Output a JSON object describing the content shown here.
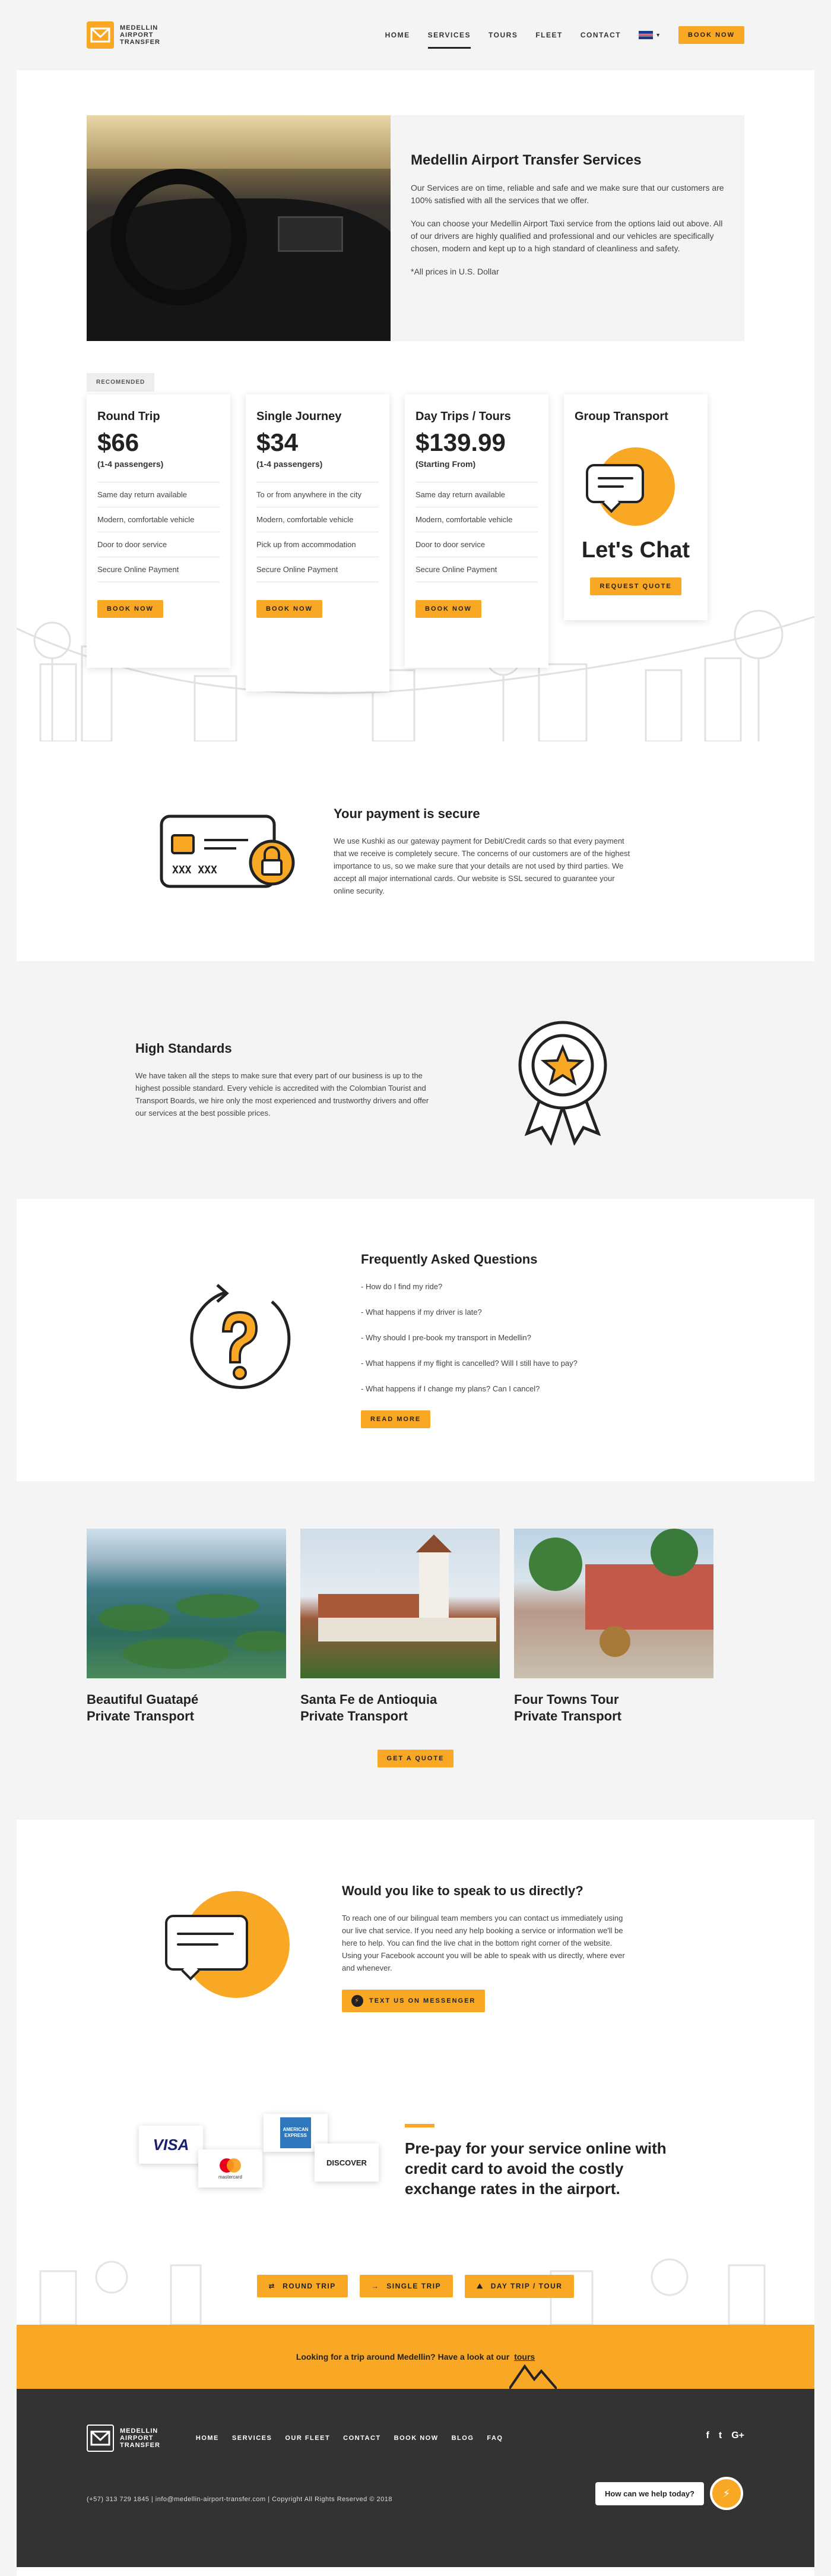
{
  "header": {
    "logo_line1": "MEDELLIN",
    "logo_line2": "AIRPORT",
    "logo_line3": "TRANSFER",
    "nav": [
      "HOME",
      "SERVICES",
      "TOURS",
      "FLEET",
      "CONTACT"
    ],
    "active_nav": "SERVICES",
    "book_now": "BOOK NOW"
  },
  "services": {
    "title": "Medellin Airport Transfer Services",
    "p1": "Our Services are on time, reliable and safe and we make sure that our customers are 100% satisfied with all the services that we offer.",
    "p2": "You can choose your Medellin Airport Taxi service from the options laid out above. All of our drivers are highly qualified and professional and our vehicles are specifically chosen, modern and kept up to a high standard of cleanliness and safety.",
    "p3": "*All prices in U.S. Dollar"
  },
  "pricing": {
    "recommended": "RECOMENDED",
    "cards": [
      {
        "title": "Round Trip",
        "price": "$66",
        "pax": "(1-4 passengers)",
        "features": [
          "Same day return available",
          "Modern, comfortable vehicle",
          "Door to door service",
          "Secure Online Payment"
        ],
        "button": "BOOK NOW"
      },
      {
        "title": "Single Journey",
        "price": "$34",
        "pax": "(1-4 passengers)",
        "features": [
          "To or from anywhere in the city",
          "Modern, comfortable vehicle",
          "Pick up from accommodation",
          "Secure Online Payment"
        ],
        "button": "BOOK NOW"
      },
      {
        "title": "Day Trips / Tours",
        "price": "$139.99",
        "pax": "(Starting From)",
        "features": [
          "Same day return available",
          "Modern, comfortable vehicle",
          "Door to door service",
          "Secure Online Payment"
        ],
        "button": "BOOK NOW"
      },
      {
        "title": "Group Transport",
        "lets_chat": "Let's Chat",
        "button": "REQUEST QUOTE"
      }
    ]
  },
  "payment": {
    "title": "Your payment is secure",
    "text": "We use Kushki as our gateway payment for Debit/Credit cards so that every payment that we receive is completely secure. The concerns of our customers are of the highest importance to us, so we make sure that your details are not used by third parties. We accept all major international cards. Our website is SSL secured to guarantee your online security.",
    "card_icon_text": "XXX XXX"
  },
  "standards": {
    "title": "High Standards",
    "text": "We have taken all the steps to make sure that every part of our business is up to the highest possible standard. Every vehicle is accredited with the Colombian Tourist and Transport Boards, we hire only the most experienced and trustworthy drivers and offer our services at the best possible prices."
  },
  "faq": {
    "title": "Frequently Asked Questions",
    "items": [
      "- How do I find my ride?",
      "- What happens if my driver is late?",
      "- Why should I pre-book my transport in Medellin?",
      "- What happens if my flight is cancelled? Will I still have to pay?",
      "- What happens if I change my plans? Can I cancel?"
    ],
    "button": "READ MORE"
  },
  "tours": {
    "items": [
      {
        "line1": "Beautiful Guatapé",
        "line2": "Private Transport"
      },
      {
        "line1": "Santa Fe de Antioquia",
        "line2": "Private Transport"
      },
      {
        "line1": "Four Towns Tour",
        "line2": "Private Transport"
      }
    ],
    "button": "GET A QUOTE"
  },
  "speak": {
    "title": "Would you like to speak to us directly?",
    "text": "To reach one of our bilingual team members you can contact us immediately using our live chat service. If you need any help booking a service or information we'll be here to help. You can find the live chat in the bottom right corner of the website. Using your Facebook account you will be able to speak with us directly, where ever and whenever.",
    "button": "TEXT US ON MESSENGER"
  },
  "prepay": {
    "title": "Pre-pay for your service online with credit card to avoid the costly exchange rates in the airport.",
    "logos": [
      "VISA",
      "mastercard",
      "AMERICAN EXPRESS",
      "DISCOVER"
    ]
  },
  "quick_links": [
    "ROUND TRIP",
    "SINGLE TRIP",
    "DAY TRIP / TOUR"
  ],
  "strip": {
    "text": "Looking for a trip around Medellin?  Have a look at our",
    "link": "tours"
  },
  "footer": {
    "nav": [
      "HOME",
      "SERVICES",
      "OUR FLEET",
      "CONTACT",
      "BOOK NOW",
      "BLOG",
      "FAQ"
    ],
    "bottom": "(+57) 313 729 1845  |  info@medellin-airport-transfer.com  |  Copyright All Rights Reserved © 2018",
    "social": [
      "f",
      "t",
      "G+"
    ],
    "help": "How can we help today?"
  },
  "colors": {
    "accent": "#f9a825",
    "dark": "#333333"
  }
}
